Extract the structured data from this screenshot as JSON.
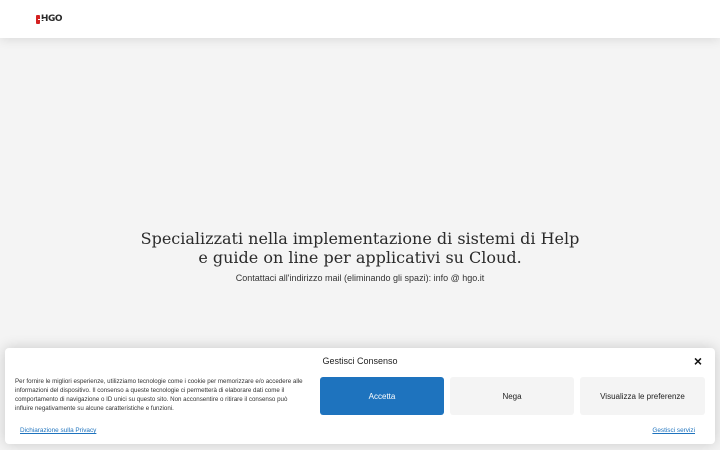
{
  "header": {
    "logo_text": "HGO"
  },
  "hero": {
    "title_line1": "Specializzati nella implementazione di sistemi di Help",
    "title_line2": "e guide on line per applicativi su Cloud.",
    "contact": "Contattaci all'indirizzo mail (eliminando gli spazi): info @ hgo.it"
  },
  "cookie": {
    "title": "Gestisci Consenso",
    "close_icon": "×",
    "text": "Per fornire le migliori esperienze, utilizziamo tecnologie come i cookie per memorizzare e/o accedere alle informazioni del dispositivo. Il consenso a queste tecnologie ci permetterà di elaborare dati come il comportamento di navigazione o ID unici su questo sito. Non acconsentire o ritirare il consenso può influire negativamente su alcune caratteristiche e funzioni.",
    "accept_label": "Accetta",
    "deny_label": "Nega",
    "prefs_label": "Visualizza le preferenze",
    "privacy_link": "Dichiarazione sulla Privacy",
    "services_link": "Gestisci servizi"
  },
  "colors": {
    "accent": "#1e73be",
    "logo_red": "#d42121",
    "page_bg": "#f4f4f4"
  }
}
